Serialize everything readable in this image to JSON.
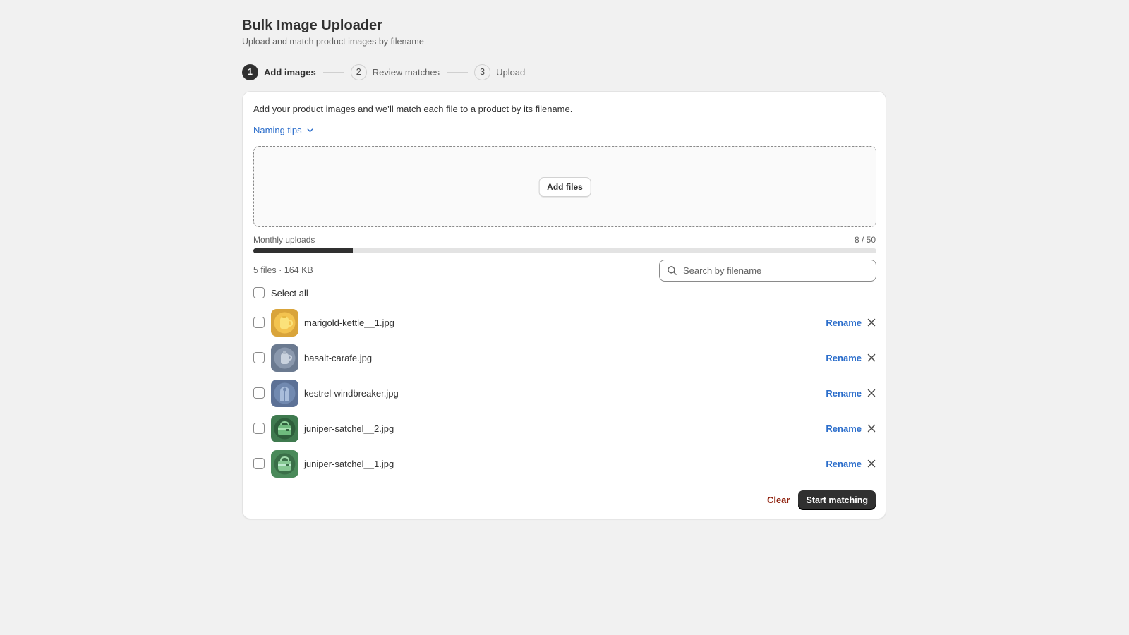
{
  "header": {
    "title": "Bulk Image Uploader",
    "subtitle": "Upload and match product images by filename"
  },
  "steps": [
    {
      "number": "1",
      "label": "Add images",
      "active": true
    },
    {
      "number": "2",
      "label": "Review matches",
      "active": false
    },
    {
      "number": "3",
      "label": "Upload",
      "active": false
    }
  ],
  "card": {
    "intro": "Add your product images and we’ll match each file to a product by its filename.",
    "naming_tips": "Naming tips",
    "add_files_label": "Add files",
    "quota": {
      "label": "Monthly uploads",
      "count_text": "8 / 50",
      "used": 8,
      "limit": 50
    },
    "file_summary": "5 files · 164 KB",
    "search": {
      "placeholder": "Search by filename",
      "value": ""
    },
    "select_all_label": "Select all",
    "files": [
      {
        "name": "marigold-kettle__1.jpg",
        "thumb_icon": "kettle-icon",
        "thumb_color": "#d9a43a",
        "rename_label": "Rename"
      },
      {
        "name": "basalt-carafe.jpg",
        "thumb_icon": "carafe-icon",
        "thumb_color": "#6b7a90",
        "rename_label": "Rename"
      },
      {
        "name": "kestrel-windbreaker.jpg",
        "thumb_icon": "jacket-icon",
        "thumb_color": "#5c7196",
        "rename_label": "Rename"
      },
      {
        "name": "juniper-satchel__2.jpg",
        "thumb_icon": "satchel-icon",
        "thumb_color": "#3f7a4f",
        "rename_label": "Rename"
      },
      {
        "name": "juniper-satchel__1.jpg",
        "thumb_icon": "satchel-icon",
        "thumb_color": "#4a8a5a",
        "rename_label": "Rename"
      }
    ],
    "clear_label": "Clear",
    "start_label": "Start matching"
  },
  "colors": {
    "accent_link": "#2c6ecb",
    "primary_button": "#303030",
    "critical": "#8e1f0b",
    "background": "#f1f1f1"
  }
}
